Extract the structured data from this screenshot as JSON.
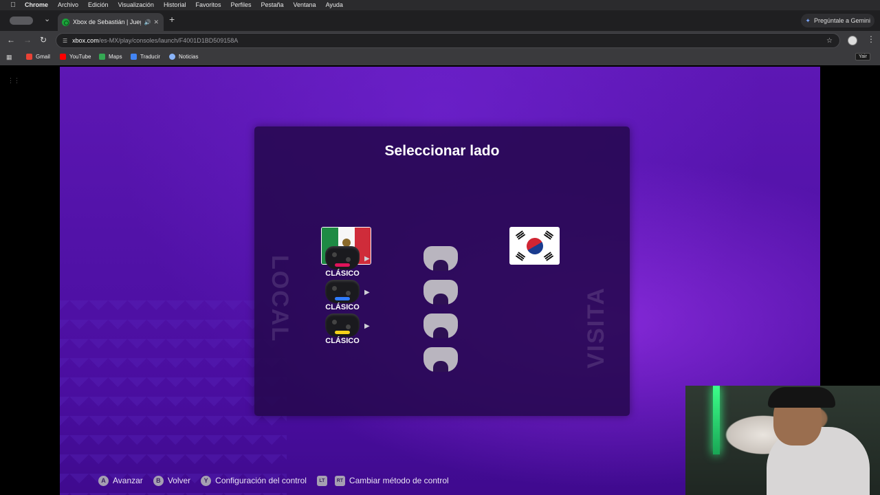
{
  "menubar": {
    "app": "Chrome",
    "items": [
      "Archivo",
      "Edición",
      "Visualización",
      "Historial",
      "Favoritos",
      "Perfiles",
      "Pestaña",
      "Ventana",
      "Ayuda"
    ]
  },
  "tab": {
    "title": "Xbox de Sebastián | Jueg"
  },
  "gemini_label": "Pregúntale a Gemini",
  "omnibox": {
    "host": "xbox.com",
    "path": "/es-MX/play/consoles/launch/F4001D1BD509158A"
  },
  "bookmarks": [
    "Gmail",
    "YouTube",
    "Maps",
    "Traducir",
    "Noticias"
  ],
  "profile_tooltip": "Yair",
  "game": {
    "title": "Seleccionar lado",
    "home_flag": "Mexico",
    "away_flag": "South Korea",
    "home_label": "LOCAL",
    "away_label": "VISITA",
    "controllers": [
      {
        "label": "CLÁSICO",
        "accent": "#e0135a"
      },
      {
        "label": "CLÁSICO",
        "accent": "#2f7bff"
      },
      {
        "label": "CLÁSICO",
        "accent": "#f5d21a"
      }
    ],
    "empty_slots": 4,
    "hints": [
      {
        "glyph": "A",
        "label": "Avanzar"
      },
      {
        "glyph": "B",
        "label": "Volver"
      },
      {
        "glyph": "Y",
        "label": "Configuración del control"
      },
      {
        "glyph": "LT",
        "label": ""
      },
      {
        "glyph": "RT",
        "label": "Cambiar método de control"
      }
    ]
  }
}
